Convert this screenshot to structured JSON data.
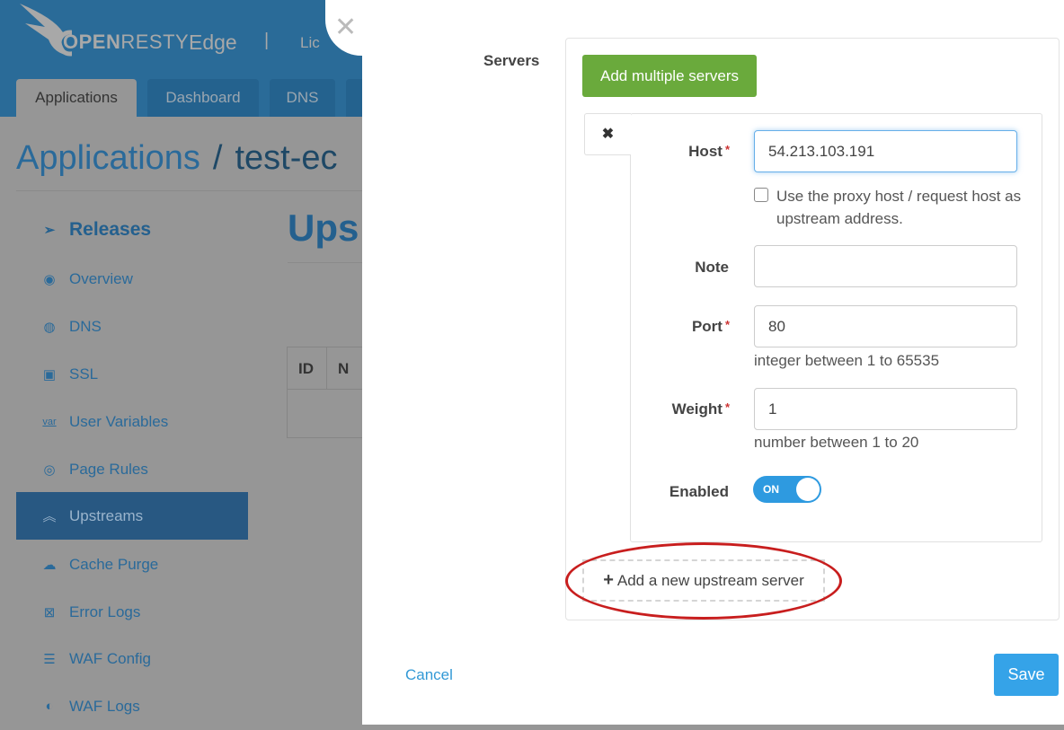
{
  "header": {
    "brand_prefix": "OPEN",
    "brand_suffix": "RESTY",
    "product": "Edge",
    "separator": "|",
    "license_partial": "Lic",
    "tabs": [
      {
        "label": "Applications",
        "active": true
      },
      {
        "label": "Dashboard"
      },
      {
        "label": "DNS"
      }
    ]
  },
  "breadcrumb": {
    "root": "Applications",
    "separator": "/",
    "current_partial": "test-ec"
  },
  "page_title_partial": "Ups",
  "sidebar": {
    "items": [
      {
        "label": "Releases",
        "icon": "paper-plane-icon"
      },
      {
        "label": "Overview",
        "icon": "dashboard-icon"
      },
      {
        "label": "DNS",
        "icon": "globe-icon"
      },
      {
        "label": "SSL",
        "icon": "lock-icon"
      },
      {
        "label": "User Variables",
        "icon": "var-icon"
      },
      {
        "label": "Page Rules",
        "icon": "rule-icon"
      },
      {
        "label": "Upstreams",
        "icon": "chevrons-up-icon",
        "active": true
      },
      {
        "label": "Cache Purge",
        "icon": "cloud-icon"
      },
      {
        "label": "Error Logs",
        "icon": "error-log-icon"
      },
      {
        "label": "WAF Config",
        "icon": "list-icon"
      },
      {
        "label": "WAF Logs",
        "icon": "waf-log-icon"
      }
    ]
  },
  "table": {
    "headers": [
      "ID",
      "N"
    ]
  },
  "modal": {
    "servers_label": "Servers",
    "add_multiple_label": "Add multiple servers",
    "server": {
      "host_label": "Host",
      "host_value": "54.213.103.191",
      "proxy_host_label": "Use the proxy host / request host as upstream address.",
      "proxy_host_checked": false,
      "note_label": "Note",
      "note_value": "",
      "port_label": "Port",
      "port_value": "80",
      "port_help": "integer between 1 to 65535",
      "weight_label": "Weight",
      "weight_value": "1",
      "weight_help": "number between 1 to 20",
      "enabled_label": "Enabled",
      "enabled_state": "ON"
    },
    "required_mark": "*",
    "add_new_label": "Add a new upstream server",
    "cancel_label": "Cancel",
    "save_label": "Save"
  },
  "colors": {
    "accent": "#35a3e8",
    "green": "#6aaa3c",
    "annotation": "#c81e1e"
  }
}
